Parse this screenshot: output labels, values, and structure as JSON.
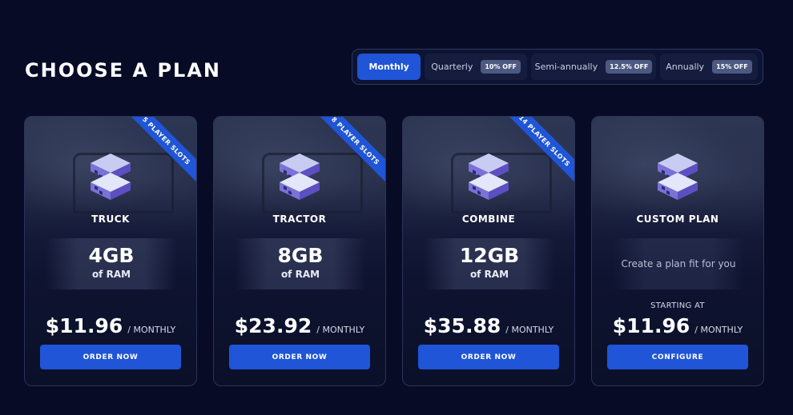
{
  "page": {
    "title": "CHOOSE A PLAN"
  },
  "billing": {
    "options": [
      {
        "label": "Monthly",
        "badge": ""
      },
      {
        "label": "Quarterly",
        "badge": "10% OFF"
      },
      {
        "label": "Semi-annually",
        "badge": "12.5% OFF"
      },
      {
        "label": "Annually",
        "badge": "15% OFF"
      }
    ],
    "selected": "Monthly"
  },
  "plans": [
    {
      "name": "TRUCK",
      "ribbon": "5 PLAYER SLOTS",
      "ram": "4GB",
      "ram_unit": "of RAM",
      "price": "$11.96",
      "period": "/ MONTHLY",
      "button": "ORDER NOW"
    },
    {
      "name": "TRACTOR",
      "ribbon": "8 PLAYER SLOTS",
      "ram": "8GB",
      "ram_unit": "of RAM",
      "price": "$23.92",
      "period": "/ MONTHLY",
      "button": "ORDER NOW"
    },
    {
      "name": "COMBINE",
      "ribbon": "14 PLAYER SLOTS",
      "ram": "12GB",
      "ram_unit": "of RAM",
      "price": "$35.88",
      "period": "/ MONTHLY",
      "button": "ORDER NOW"
    },
    {
      "name": "CUSTOM PLAN",
      "description": "Create a plan fit for you",
      "starting_label": "STARTING AT",
      "price": "$11.96",
      "period": "/ MONTHLY",
      "button": "CONFIGURE"
    }
  ],
  "icons": {
    "plan": "server-stack-icon"
  },
  "colors": {
    "background": "#070b26",
    "accent": "#1f55d6",
    "badge": "#4c5a82"
  }
}
